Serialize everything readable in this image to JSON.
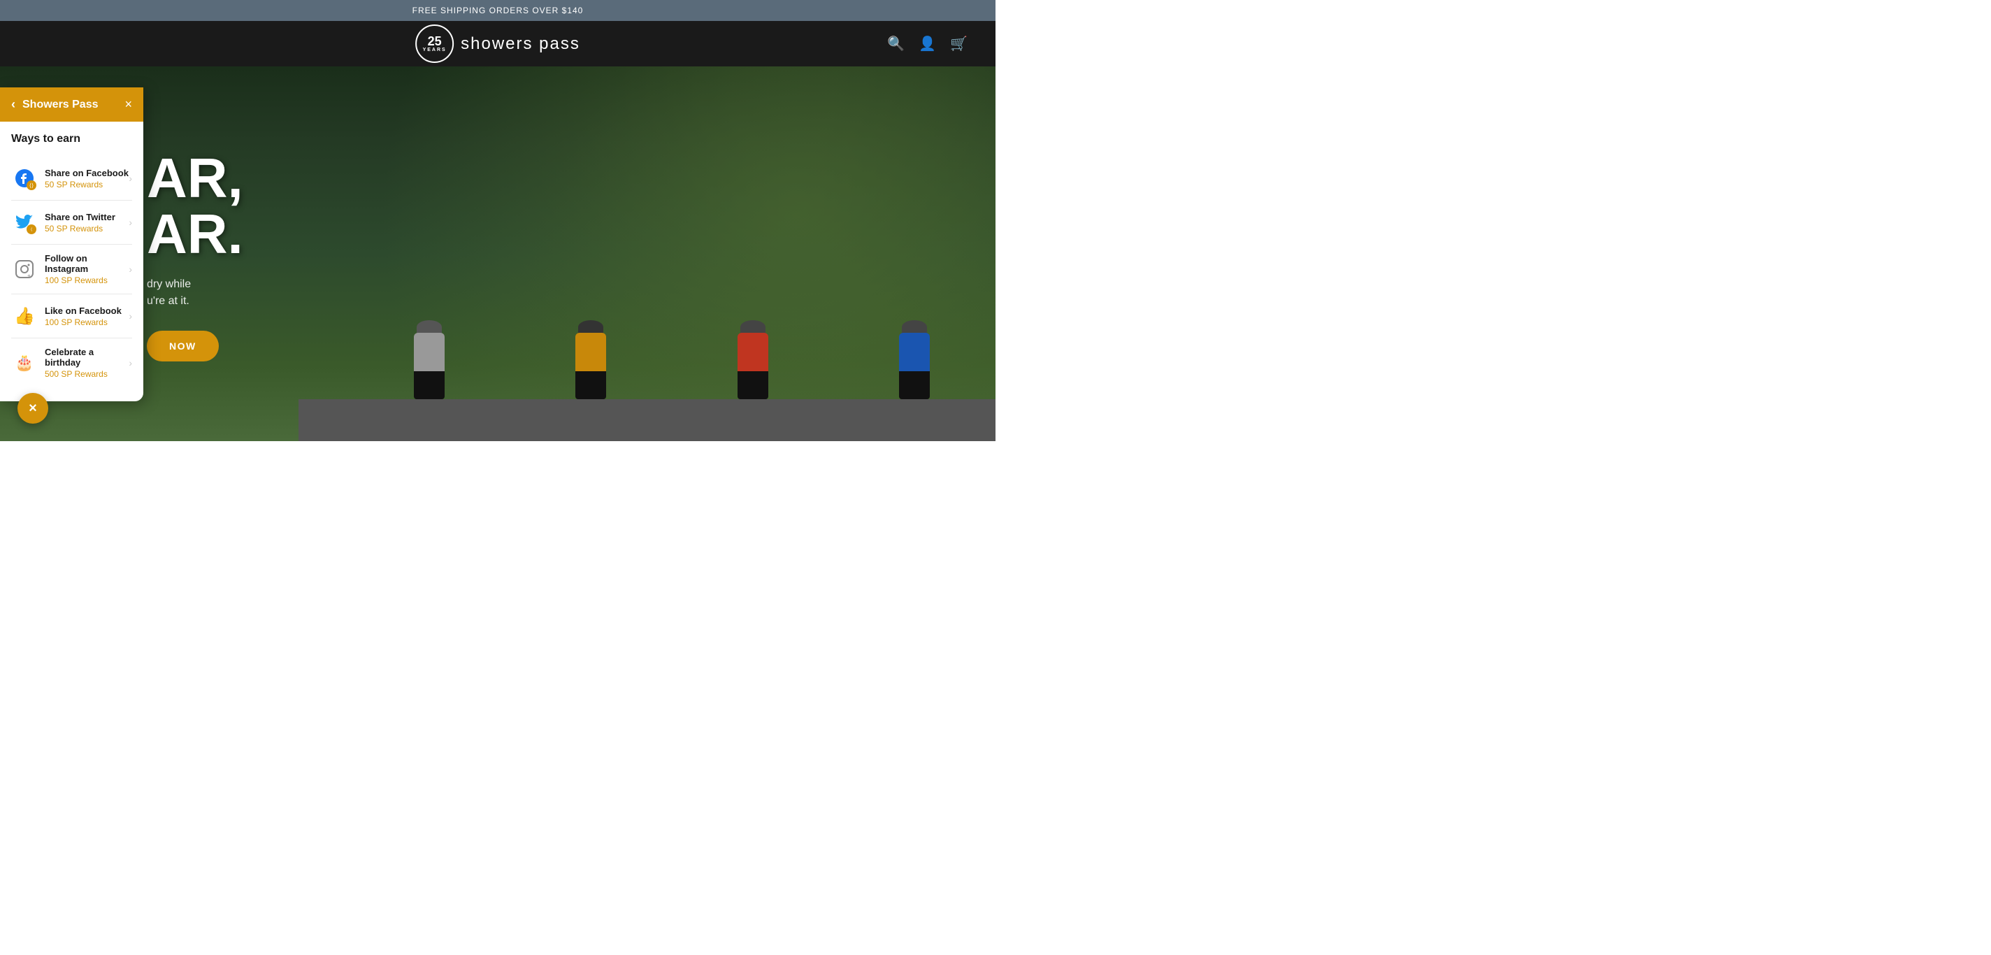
{
  "announcement": {
    "text": "FREE SHIPPING ORDERS OVER $140"
  },
  "header": {
    "logo_text": "showers pass",
    "logo_years": "25",
    "logo_years_label": "YEARS"
  },
  "hero": {
    "headline_line1": "AR,",
    "headline_line2": "AR.",
    "description_line1": "dry while",
    "description_line2": "u're at it.",
    "cta_label": "NOW"
  },
  "rewards_panel": {
    "title": "Showers Pass",
    "section_title": "Ways to earn",
    "items": [
      {
        "name": "Share on Facebook",
        "points": "50 SP Rewards",
        "icon": "facebook"
      },
      {
        "name": "Share on Twitter",
        "points": "50 SP Rewards",
        "icon": "twitter"
      },
      {
        "name": "Follow on Instagram",
        "points": "100 SP Rewards",
        "icon": "instagram"
      },
      {
        "name": "Like on Facebook",
        "points": "100 SP Rewards",
        "icon": "thumbs-up"
      },
      {
        "name": "Celebrate a birthday",
        "points": "500 SP Rewards",
        "icon": "birthday"
      }
    ],
    "back_label": "‹",
    "close_label": "×"
  },
  "floating_close": {
    "label": "×"
  }
}
